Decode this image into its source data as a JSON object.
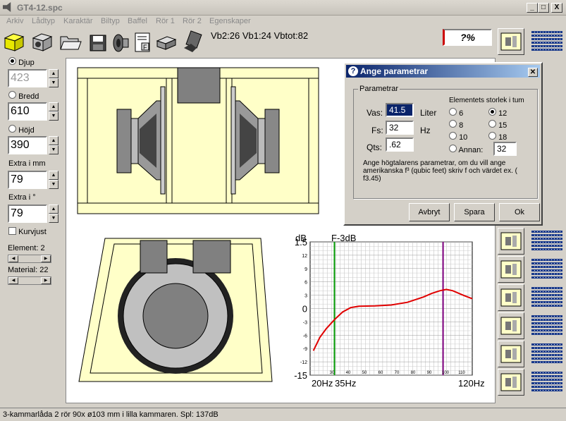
{
  "window": {
    "title": "GT4-12.spc",
    "min": "_",
    "max": "□",
    "close": "X"
  },
  "menu": [
    "Arkiv",
    "Lådtyp",
    "Karaktär",
    "Biltyp",
    "Baffel",
    "Rör 1",
    "Rör 2",
    "Egenskaper"
  ],
  "toolbar": {
    "icons": [
      "yellow-box-icon",
      "speaker-box-icon",
      "open-folder-icon",
      "save-disk-icon",
      "speaker-driver-icon",
      "document-f-icon",
      "printer-icon",
      "calculator-hand-icon"
    ]
  },
  "info": {
    "vb_text": "Vb2:26 Vb1:24 Vbtot:82",
    "percent": "?%"
  },
  "left": {
    "djup_label": "Djup",
    "djup_value": "423",
    "bredd_label": "Bredd",
    "bredd_value": "610",
    "hojd_label": "Höjd",
    "hojd_value": "390",
    "extra_mm_label": "Extra i mm",
    "extra_mm_value": "79",
    "extra_deg_label": "Extra i °",
    "extra_deg_value": "79",
    "kurvjust_label": "Kurvjust",
    "element_label": "Element: 2",
    "material_label": "Material: 22"
  },
  "dialog": {
    "title": "Ange parametrar",
    "group": "Parametrar",
    "vas_label": "Vas:",
    "vas_value": "41.5",
    "vas_unit": "Liter",
    "fs_label": "Fs:",
    "fs_value": "32",
    "fs_unit": "Hz",
    "qts_label": "Qts:",
    "qts_value": ".62",
    "size_title": "Elementets storlek i tum",
    "sizes": [
      "6",
      "8",
      "10",
      "12",
      "15",
      "18"
    ],
    "selected_size": "12",
    "annan_label": "Annan:",
    "annan_value": "32",
    "help": "Ange högtalarens parametrar, om du vill ange amerikanska f³ (qubic feet) skriv f och värdet ex. ( f3.45)",
    "cancel": "Avbryt",
    "save": "Spara",
    "ok": "Ok"
  },
  "chart_data": {
    "type": "line",
    "ylabel": "dB",
    "marker_label": "F-3dB",
    "x_range": [
      20,
      120
    ],
    "ylim": [
      -15,
      15
    ],
    "y_ticks": [
      15,
      12,
      9,
      6,
      3,
      0,
      -3,
      -6,
      -9,
      -12,
      -15
    ],
    "y_tick_labels": [
      "1.5",
      "12",
      "9",
      "6",
      "3",
      "0",
      "-3",
      "-6",
      "-9",
      "-12",
      "-15"
    ],
    "x_tick_labels": [
      "20Hz",
      "35Hz",
      "120Hz"
    ],
    "x_minor_labels": [
      "30",
      "40",
      "50",
      "60",
      "70",
      "80",
      "90",
      "100",
      "110"
    ],
    "vlines": [
      {
        "x": 35,
        "color": "#009900"
      },
      {
        "x": 102,
        "color": "#800080"
      }
    ],
    "series": [
      {
        "color": "#e00000",
        "x": [
          22,
          26,
          30,
          35,
          40,
          45,
          50,
          60,
          70,
          80,
          90,
          95,
          100,
          104,
          108,
          115,
          120
        ],
        "y": [
          -9.5,
          -6.5,
          -4.5,
          -2.5,
          -0.8,
          0.2,
          0.5,
          0.6,
          0.8,
          1.4,
          2.6,
          3.4,
          4.0,
          4.3,
          4.0,
          2.9,
          2.2
        ]
      }
    ]
  },
  "thumbs": 7,
  "status": "3-kammarlåda 2 rör 90x ø103 mm i lilla kammaren. Spl: 137dB"
}
